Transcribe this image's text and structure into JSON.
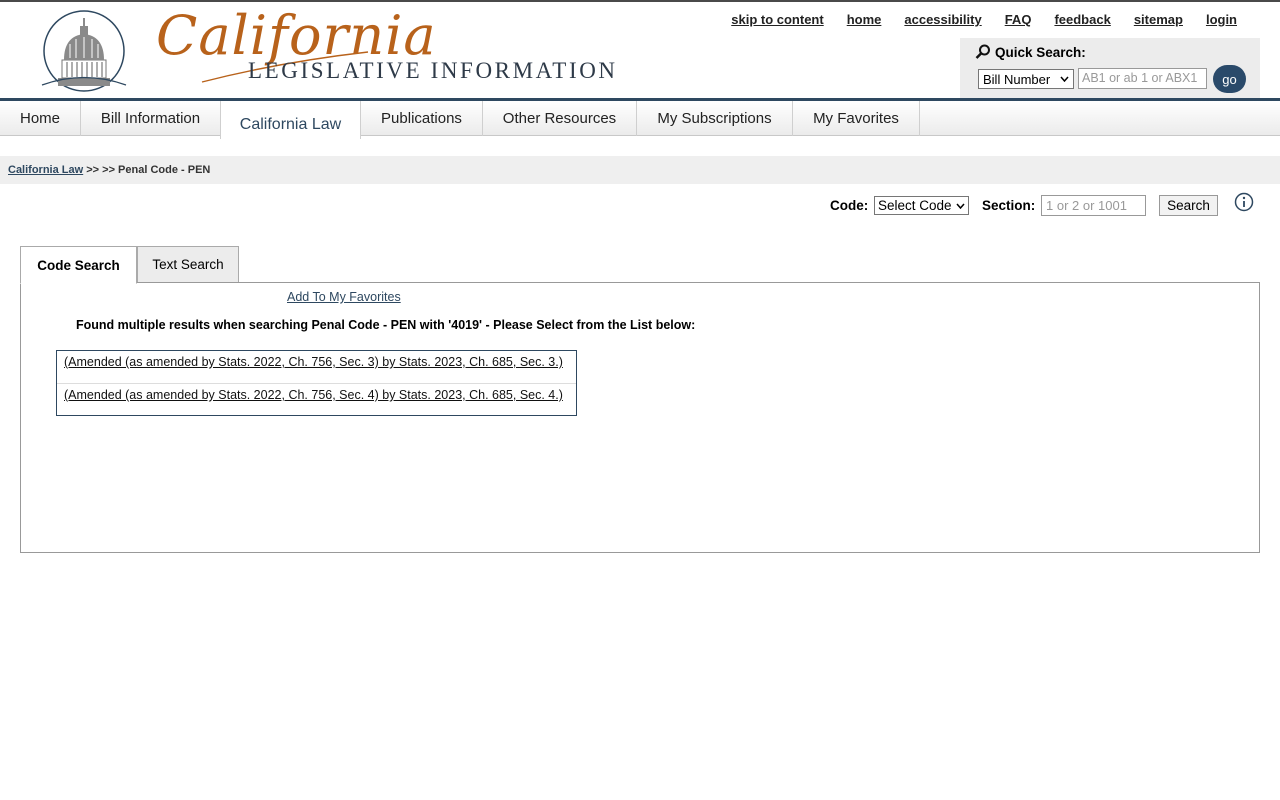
{
  "header": {
    "logo_script": "California",
    "logo_sub": "LEGISLATIVE INFORMATION",
    "brand_color": "#b8621b",
    "navy": "#2e4860"
  },
  "toplinks": [
    "skip to content",
    "home",
    "accessibility",
    "FAQ",
    "feedback",
    "sitemap",
    "login"
  ],
  "quick_search": {
    "title": "Quick Search:",
    "type_value": "Bill Number",
    "placeholder": "AB1 or ab 1 or ABX1",
    "go_label": "go"
  },
  "nav": {
    "items": [
      "Home",
      "Bill Information",
      "California Law",
      "Publications",
      "Other Resources",
      "My Subscriptions",
      "My Favorites"
    ],
    "active": "California Law"
  },
  "breadcrumb": {
    "link": "California Law",
    "rest": " >> >> Penal Code - PEN"
  },
  "code_search": {
    "code_label": "Code:",
    "code_value": "Select Code",
    "section_label": "Section:",
    "section_placeholder": "1 or 2 or 1001",
    "search_label": "Search"
  },
  "tabs": [
    "Code Search",
    "Text Search"
  ],
  "panel": {
    "favorites_link": "Add To My Favorites",
    "message": "Found multiple results when searching Penal Code - PEN with '4019' - Please Select from the List below:",
    "results": [
      "(Amended (as amended by Stats. 2022, Ch. 756, Sec. 3) by Stats. 2023, Ch. 685, Sec. 3.)",
      "(Amended (as amended by Stats. 2022, Ch. 756, Sec. 4) by Stats. 2023, Ch. 685, Sec. 4.)"
    ]
  }
}
